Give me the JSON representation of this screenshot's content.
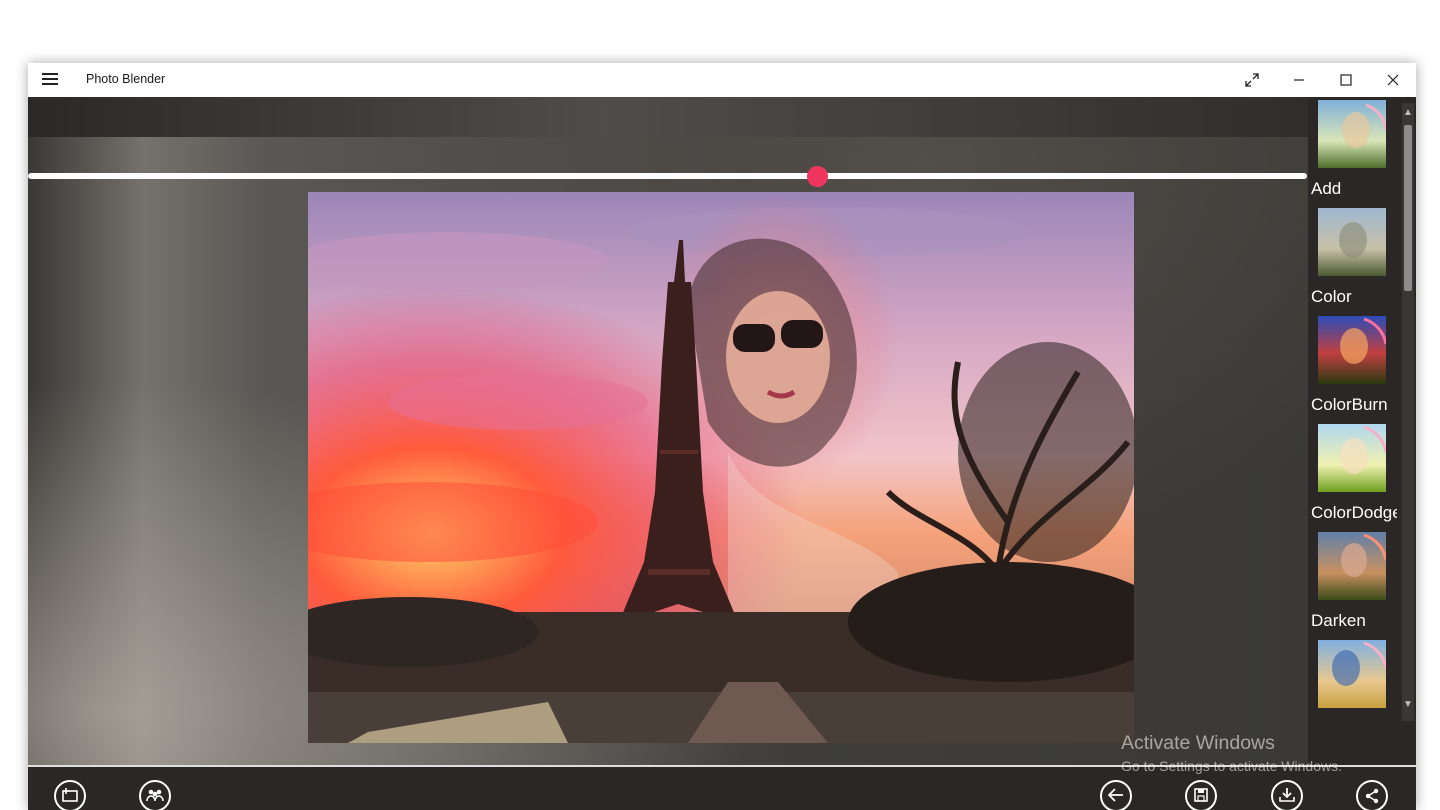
{
  "window": {
    "title": "Photo Blender",
    "controls": [
      "fullscreen-icon",
      "minimize-icon",
      "maximize-icon",
      "close-icon"
    ]
  },
  "slider": {
    "value_fraction": 0.617
  },
  "blend_modes": [
    {
      "label": "Add",
      "icon": "blend-preview-image"
    },
    {
      "label": "Color",
      "icon": "blend-preview-image"
    },
    {
      "label": "ColorBurn",
      "icon": "blend-preview-image"
    },
    {
      "label": "ColorDodge",
      "icon": "blend-preview-image"
    },
    {
      "label": "Darken",
      "icon": "blend-preview-image"
    },
    {
      "label": "",
      "icon": "blend-preview-image"
    }
  ],
  "toolbar": {
    "left": [
      "open-photo-icon",
      "people-icon"
    ],
    "right": [
      "back-icon",
      "save-icon",
      "download-icon",
      "share-icon"
    ]
  },
  "watermark": {
    "title": "Activate Windows",
    "subtitle": "Go to Settings to activate Windows."
  },
  "colors": {
    "accent": "#f0365f",
    "chrome_dark": "#2b2727",
    "titlebar": "#ffffff"
  }
}
